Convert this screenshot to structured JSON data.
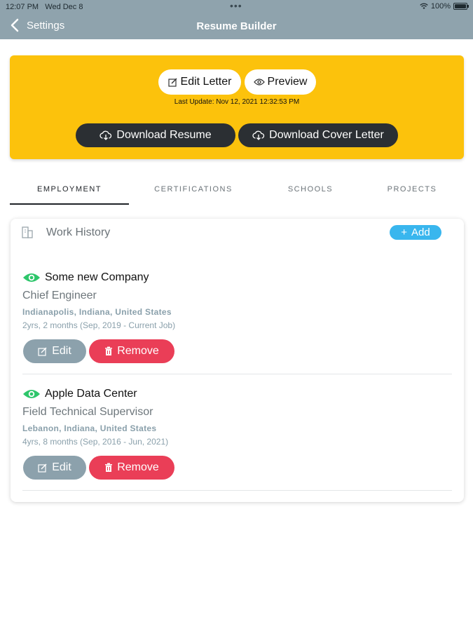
{
  "status_bar": {
    "time": "12:07 PM",
    "date": "Wed Dec 8",
    "battery": "100%"
  },
  "nav": {
    "back_label": "Settings",
    "title": "Resume Builder"
  },
  "banner": {
    "edit_letter": "Edit Letter",
    "preview": "Preview",
    "last_update": "Last Update: Nov 12, 2021 12:32:53 PM",
    "download_resume": "Download Resume",
    "download_cover_letter": "Download Cover Letter",
    "color": "#fcc20c"
  },
  "tabs": [
    {
      "label": "EMPLOYMENT",
      "active": true
    },
    {
      "label": "CERTIFICATIONS",
      "active": false
    },
    {
      "label": "SCHOOLS",
      "active": false
    },
    {
      "label": "PROJECTS",
      "active": false
    }
  ],
  "work_history": {
    "title": "Work History",
    "add_label": "Add",
    "jobs": [
      {
        "company": "Some new Company",
        "position": "Chief Engineer",
        "location": "Indianapolis, Indiana, United States",
        "duration": "2yrs, 2 months (Sep, 2019 - Current Job)",
        "edit_label": "Edit",
        "remove_label": "Remove"
      },
      {
        "company": "Apple Data Center",
        "position": "Field Technical Supervisor",
        "location": "Lebanon, Indiana, United States",
        "duration": "4yrs, 8 months (Sep, 2016 - Jun, 2021)",
        "edit_label": "Edit",
        "remove_label": "Remove"
      }
    ]
  },
  "colors": {
    "accent_blue": "#39b6ee",
    "remove_red": "#ea3e57",
    "visible_green": "#2ec66b",
    "nav_gray": "#8fa3ad"
  }
}
